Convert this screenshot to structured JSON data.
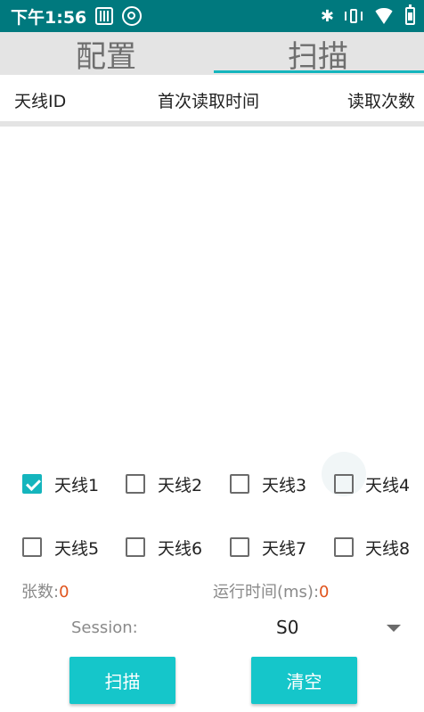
{
  "status_bar": {
    "time": "下午1:56",
    "icons": [
      "sim-card-icon",
      "at-sign-icon",
      "bluetooth-icon",
      "vibrate-icon",
      "wifi-icon",
      "battery-icon"
    ]
  },
  "tabs": [
    {
      "label": "配置",
      "active": false
    },
    {
      "label": "扫描",
      "active": true
    }
  ],
  "table": {
    "headers": [
      "天线ID",
      "首次读取时间",
      "读取次数"
    ],
    "rows": []
  },
  "antennas": [
    {
      "label": "天线1",
      "checked": true
    },
    {
      "label": "天线2",
      "checked": false
    },
    {
      "label": "天线3",
      "checked": false
    },
    {
      "label": "天线4",
      "checked": false
    },
    {
      "label": "天线5",
      "checked": false
    },
    {
      "label": "天线6",
      "checked": false
    },
    {
      "label": "天线7",
      "checked": false
    },
    {
      "label": "天线8",
      "checked": false
    }
  ],
  "stats": {
    "count_label": "张数:",
    "count_value": "0",
    "runtime_label": "运行时间(ms):",
    "runtime_value": "0"
  },
  "session": {
    "label": "Session:",
    "value": "S0"
  },
  "buttons": {
    "scan": "扫描",
    "clear": "清空"
  },
  "colors": {
    "status_bar": "#00797e",
    "accent": "#14b5bd",
    "button": "#15c6ca",
    "value_text": "#e0531c"
  }
}
